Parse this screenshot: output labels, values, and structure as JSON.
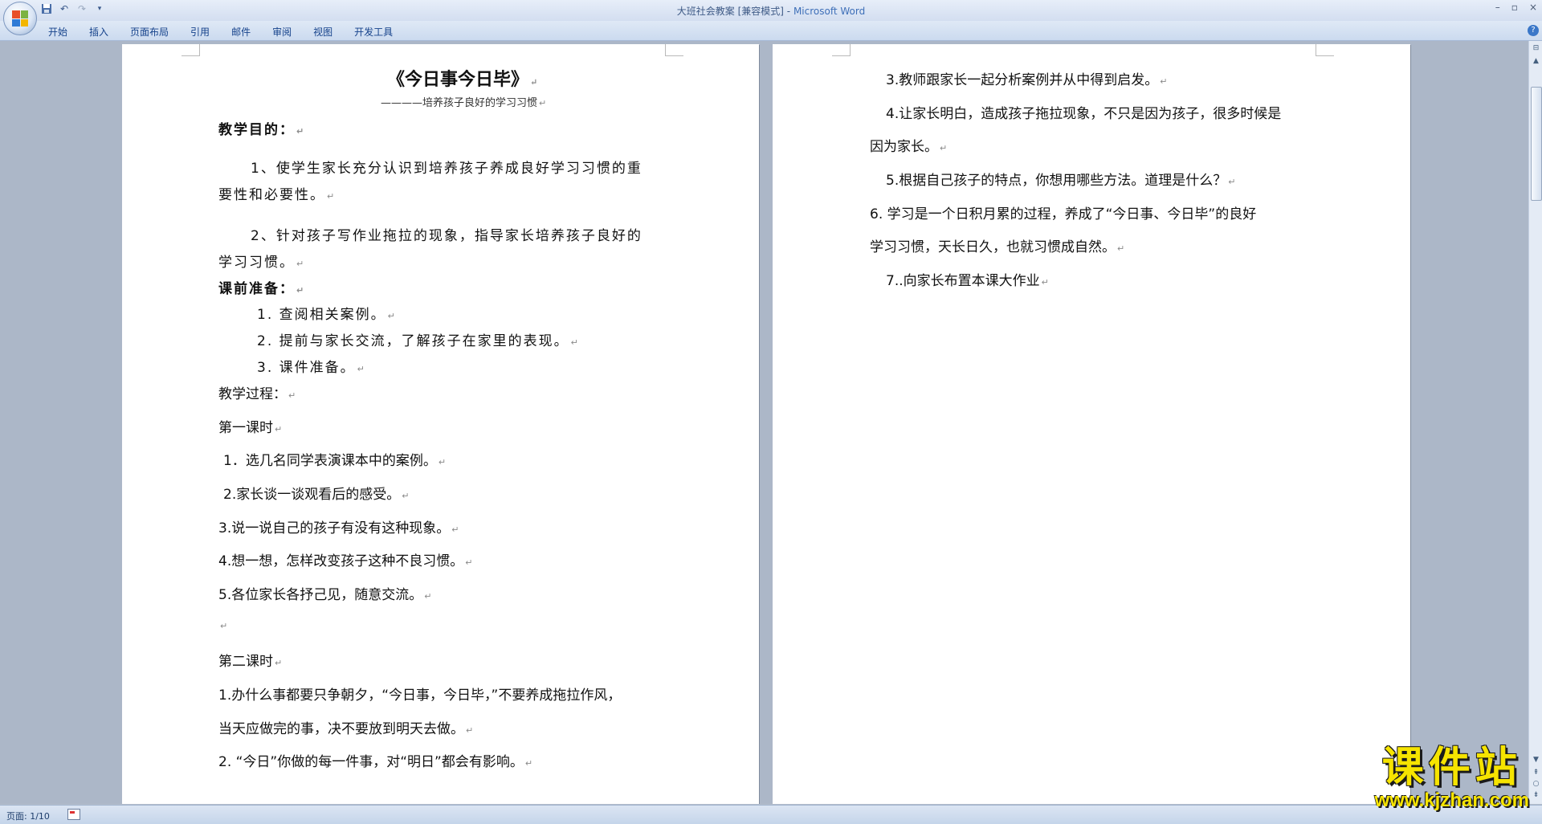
{
  "window": {
    "title_doc": "大班社会教案 [兼容模式]",
    "title_sep": " - ",
    "title_app": "Microsoft Word",
    "controls": [
      "–",
      "▫",
      "×"
    ]
  },
  "ribbon": {
    "tabs": [
      "开始",
      "插入",
      "页面布局",
      "引用",
      "邮件",
      "审阅",
      "视图",
      "开发工具"
    ],
    "help": "?"
  },
  "page1": {
    "title": "《今日事今日毕》",
    "subtitle": "————培养孩子良好的学习习惯",
    "goal_heading": "教学目的：",
    "goal1_l1": "1、使学生家长充分认识到培养孩子养成良好学习习惯的重",
    "goal1_l2": "要性和必要性。",
    "goal2_l1": "2、针对孩子写作业拖拉的现象，指导家长培养孩子良好的",
    "goal2_l2": "学习习惯。",
    "prep_heading": "课前准备：",
    "prep1": "1. 查阅相关案例。",
    "prep2": "2. 提前与家长交流，了解孩子在家里的表现。",
    "prep3": "3. 课件准备。",
    "process": "教学过程：",
    "lesson1": "第一课时",
    "l1_1": "1．选几名同学表演课本中的案例。",
    "l1_2": "2.家长谈一谈观看后的感受。",
    "l1_3": "3.说一说自己的孩子有没有这种现象。",
    "l1_4": "4.想一想，怎样改变孩子这种不良习惯。",
    "l1_5": "5.各位家长各抒己见，随意交流。",
    "lesson2": "第二课时",
    "l2_1_a": "1.办什么事都要只争朝夕，“今日事，今日毕，”不要养成拖拉作风，",
    "l2_1_b": "当天应做完的事，决不要放到明天去做。",
    "l2_2": "2. “今日”你做的每一件事，对“明日”都会有影响。"
  },
  "page2": {
    "p3": "3.教师跟家长一起分析案例并从中得到启发。",
    "p4_a": "4.让家长明白，造成孩子拖拉现象，不只是因为孩子，很多时候是",
    "p4_b": "因为家长。",
    "p5": "5.根据自己孩子的特点，你想用哪些方法。道理是什么？",
    "p6_a": "6. 学习是一个日积月累的过程，养成了“今日事、今日毕”的良好",
    "p6_b": "学习习惯，天长日久，也就习惯成自然。",
    "p7": "7..向家长布置本课大作业"
  },
  "status": {
    "page": "页面: 1/10"
  },
  "watermark": {
    "cn": "课件站",
    "url": "www.kjzhan.com"
  },
  "marks": {
    "para": "↵"
  },
  "colors": {
    "yellow": "#f6e400",
    "accent": "#15428b"
  }
}
